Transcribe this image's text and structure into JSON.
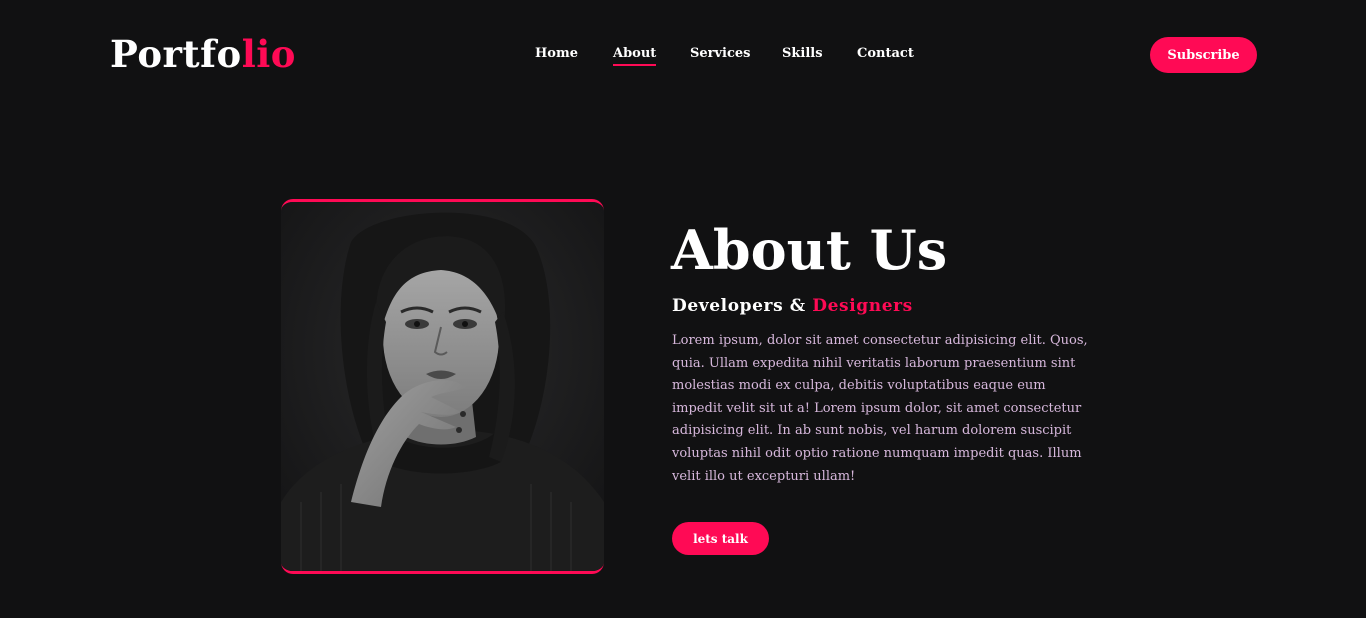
{
  "header": {
    "logo_main": "Portfo",
    "logo_accent": "lio",
    "nav": [
      {
        "label": "Home"
      },
      {
        "label": "About"
      },
      {
        "label": "Services"
      },
      {
        "label": "Skills"
      },
      {
        "label": "Contact"
      }
    ],
    "active_nav": "About",
    "subscribe_label": "Subscribe"
  },
  "about": {
    "title": "About Us",
    "subtitle_main": "Developers & ",
    "subtitle_accent": "Designers",
    "paragraph": "Lorem ipsum, dolor sit amet consectetur adipisicing elit. Quos, quia. Ullam expedita nihil veritatis laborum praesentium sint molestias modi ex culpa, debitis voluptatibus eaque eum impedit velit sit ut a! Lorem ipsum dolor, sit amet consectetur adipisicing elit. In ab sunt nobis, vel harum dolorem suscipit voluptas nihil odit optio ratione numquam impedit quas. Illum velit illo ut excepturi ullam!",
    "cta_label": "lets talk"
  },
  "colors": {
    "accent": "#ff0a55",
    "background": "#111112",
    "paragraph": "#d7b8dc"
  }
}
